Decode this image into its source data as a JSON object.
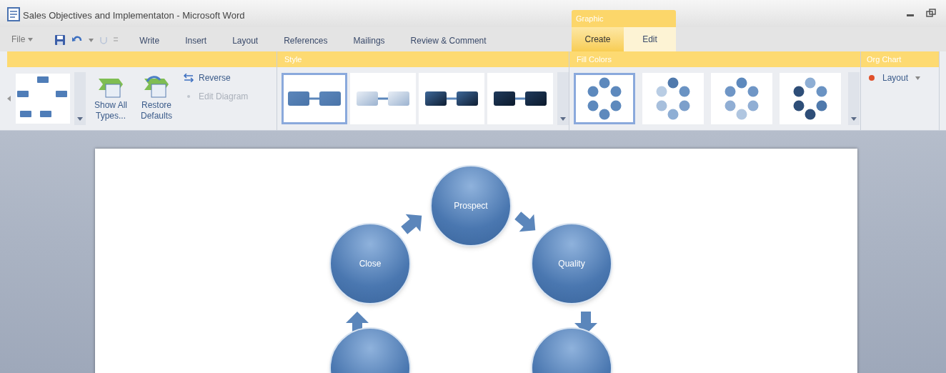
{
  "window": {
    "title": "Sales Objectives and Implementaton - Microsoft Word"
  },
  "file_menu": {
    "label": "File"
  },
  "tabs": [
    {
      "label": "Write",
      "selected": false
    },
    {
      "label": "Insert",
      "selected": false
    },
    {
      "label": "Layout",
      "selected": false
    },
    {
      "label": "References",
      "selected": false
    },
    {
      "label": "Mailings",
      "selected": false
    },
    {
      "label": "Review & Comment",
      "selected": false
    }
  ],
  "contextual": {
    "label": "Graphic",
    "tabs": [
      {
        "label": "Create",
        "selected": true
      },
      {
        "label": "Edit",
        "selected": false
      }
    ]
  },
  "ribbon": {
    "layout_group": {
      "buttons": [
        {
          "label": "Show All Types..."
        },
        {
          "label": "Restore Defaults"
        }
      ],
      "commands": [
        {
          "label": "Reverse",
          "disabled": false
        },
        {
          "label": "Edit Diagram",
          "disabled": true
        }
      ]
    },
    "style_group": {
      "label": "Style",
      "items": [
        {
          "selected": true
        },
        {
          "selected": false
        },
        {
          "selected": false
        },
        {
          "selected": false
        }
      ]
    },
    "fill_group": {
      "label": "Fill Colors",
      "items": [
        {
          "selected": true
        },
        {
          "selected": false
        },
        {
          "selected": false
        },
        {
          "selected": false
        }
      ]
    },
    "org_group": {
      "label": "Org Chart",
      "commands": [
        {
          "label": "Layout"
        }
      ]
    }
  },
  "diagram": {
    "nodes": [
      {
        "label": "Prospect"
      },
      {
        "label": "Quality"
      },
      {
        "label": "Close"
      }
    ]
  }
}
